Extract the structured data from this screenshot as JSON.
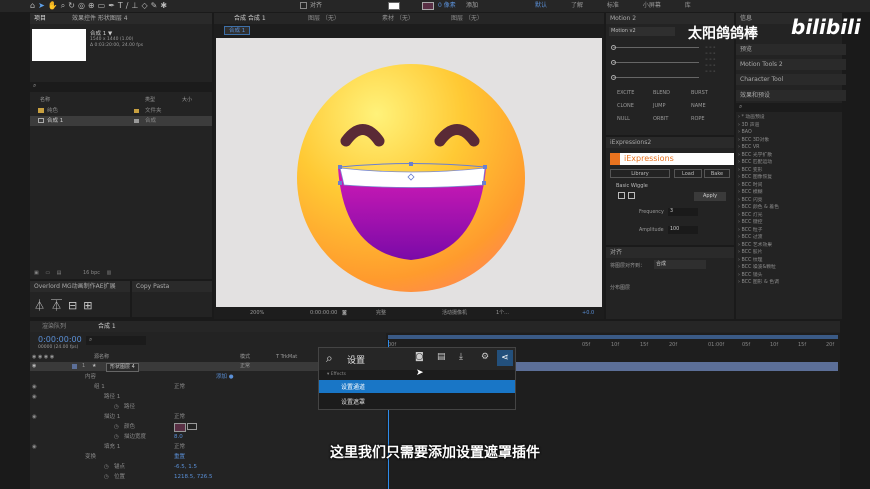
{
  "watermark": {
    "channel": "太阳鸽鸽棒",
    "brand": "bilibili"
  },
  "toolbar": {
    "align_label": "对齐",
    "pixel_value": "0 像素",
    "add_label": "添加",
    "workspaces": [
      "默认",
      "了解",
      "标准",
      "小屏幕",
      "库"
    ]
  },
  "project_panel": {
    "title": "项目",
    "tab_control": "效果控件 形状图层 4",
    "comp_name": "合成 1 ▼",
    "comp_info_1": "1540 x 1440 (1.00)",
    "comp_info_2": "Δ 0:03:20:00, 24.00 fps",
    "col_name": "名称",
    "col_type": "类型",
    "col_size": "大小",
    "items": [
      {
        "name": "纯色",
        "type": "文件夹",
        "color": "#c8a040"
      },
      {
        "name": "合成 1",
        "type": "合成",
        "color": "#9a9a9a"
      }
    ],
    "bpc": "16 bpc"
  },
  "overlord_panel": {
    "title": "Overlord  MG动画制作AE扩展",
    "sub_title": "Copy Pasta"
  },
  "viewer": {
    "tabs": [
      {
        "label": "合成  合成 1",
        "active": true
      },
      {
        "label": "图层  （无）",
        "active": false
      },
      {
        "label": "素材  （无）",
        "active": false
      },
      {
        "label": "图层  （无）",
        "active": false
      }
    ],
    "comp_crumb": "合成 1",
    "zoom": "200%",
    "timecode": "0:00:00:00",
    "quality": "完整",
    "camera": "活动摄像机",
    "views": "1个...",
    "exposure": "+0.0"
  },
  "motion_panel": {
    "title": "Motion 2",
    "version": "Motion v2",
    "buttons": [
      "EXCITE",
      "BLEND",
      "BURST",
      "CLONE",
      "JUMP",
      "NAME",
      "NULL",
      "ORBIT",
      "ROPE"
    ]
  },
  "iexpressions": {
    "title": "iExpressions2",
    "logo": "iExpressions",
    "tabs": [
      "Library",
      "Load",
      "Bake"
    ],
    "preset": "Basic Wiggle",
    "apply": "Apply",
    "frequency_label": "Frequency",
    "frequency_value": "3",
    "amplitude_label": "Amplitude",
    "amplitude_value": "100"
  },
  "align_panel": {
    "title": "对齐",
    "align_to_label": "将图层对齐到：",
    "align_to_value": "合成",
    "distribute": "分布图层"
  },
  "right_panel": {
    "info": "信息",
    "preview": "预览",
    "motion_tools": "Motion Tools 2",
    "character": "Character Tool",
    "effects_presets": "效果和预设",
    "effects": [
      "* 动画预设",
      "3D 声道",
      "BAO",
      "BCC 3D对象",
      "BCC VR",
      "BCC 光学扩散",
      "BCC 匹配运动",
      "BCC 变形",
      "BCC 图像恢复",
      "BCC 时间",
      "BCC 模糊",
      "BCC 闪亮",
      "BCC 颜色 & 着色",
      "BCC 灯光",
      "BCC 键控",
      "BCC 粒子",
      "BCC 过渡",
      "BCC 艺术效果",
      "BCC 胶片",
      "BCC 纹理",
      "BCC 噪波&颗粒",
      "BCC 镜头",
      "BCC 图形 & 色调"
    ]
  },
  "timeline": {
    "tabs": [
      "渲染队列",
      "合成 1"
    ],
    "timecode": "0:00:00:00",
    "frame_info": "00000 (24.00 fps)",
    "col_source": "源名称",
    "col_mode": "模式",
    "col_trkmat": "T  TrkMat",
    "col_parent": "父级和链接",
    "layer_num": "1",
    "layer_name": "形状图层 4",
    "layer_mode": "正常",
    "ruler_ticks": [
      "00f",
      "05f",
      "10f",
      "15f",
      "20f",
      "01:00f",
      "05f",
      "10f",
      "15f",
      "20f"
    ],
    "props": [
      {
        "indent": 70,
        "label": "内容",
        "value": "",
        "extra": "添加 ●"
      },
      {
        "indent": 90,
        "label": "组 1",
        "value": "正常",
        "extra": ""
      },
      {
        "indent": 100,
        "label": "路径 1",
        "value": "",
        "extra": ""
      },
      {
        "indent": 110,
        "label": "路径",
        "value": "",
        "extra": ""
      },
      {
        "indent": 100,
        "label": "描边 1",
        "value": "正常",
        "extra": ""
      },
      {
        "indent": 110,
        "label": "颜色",
        "value": "",
        "extra": ""
      },
      {
        "indent": 110,
        "label": "描边宽度",
        "value": "8.0",
        "extra": ""
      },
      {
        "indent": 100,
        "label": "填充 1",
        "value": "正常",
        "extra": ""
      },
      {
        "indent": 70,
        "label": "变换",
        "value": "重置",
        "extra": ""
      },
      {
        "indent": 80,
        "label": "锚点",
        "value": "-6.5, 1.5",
        "extra": ""
      },
      {
        "indent": 80,
        "label": "位置",
        "value": "1218.5, 726.5",
        "extra": ""
      }
    ]
  },
  "search_popup": {
    "query": "设置",
    "category": "Effects",
    "results": [
      {
        "label": "设置通道",
        "selected": true
      },
      {
        "label": "设置遮罩",
        "selected": false
      }
    ]
  },
  "subtitle": "这里我们只需要添加设置遮罩插件",
  "colors": {
    "accent": "#2d8ceb",
    "viewer_bg": "#e3e1e1",
    "popup_select": "#1976c6",
    "layer_bar": "#5c6f98"
  }
}
